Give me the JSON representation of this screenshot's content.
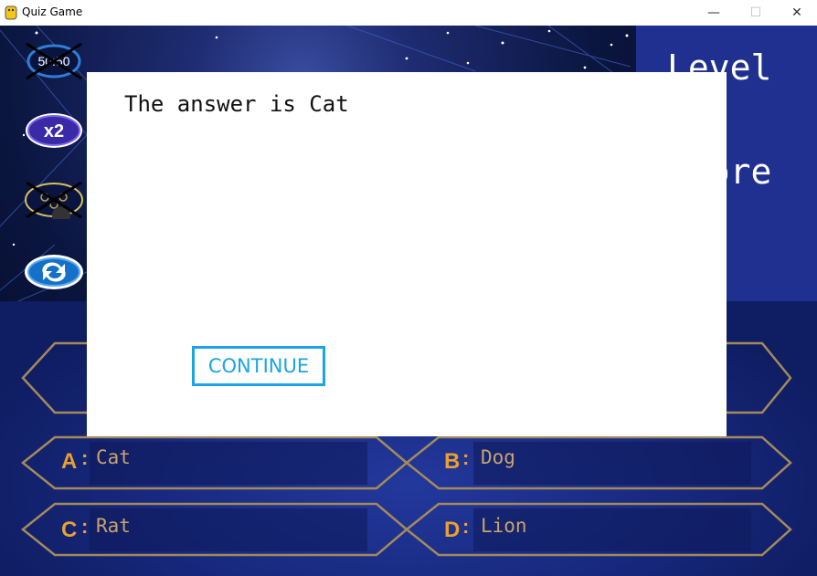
{
  "window": {
    "title": "Quiz Game",
    "minimize_glyph": "—",
    "maximize_glyph": "☐",
    "close_glyph": "✕"
  },
  "status_panel": {
    "level_label": "Level",
    "score_label": "Score"
  },
  "lifelines": [
    {
      "name": "fifty-fifty",
      "label": "50:50",
      "used": true
    },
    {
      "name": "double-chance",
      "label": "x2",
      "used": false
    },
    {
      "name": "ask-audience",
      "label": "",
      "used": true
    },
    {
      "name": "swap-question",
      "label": "",
      "used": false
    }
  ],
  "answers": [
    {
      "letter": "A",
      "text": "Cat"
    },
    {
      "letter": "B",
      "text": "Dog"
    },
    {
      "letter": "C",
      "text": "Rat"
    },
    {
      "letter": "D",
      "text": "Lion"
    }
  ],
  "dialog": {
    "message": "The answer is Cat",
    "button_label": "CONTINUE"
  },
  "colors": {
    "accent": "#1aa4e6",
    "gold": "#c7a36e",
    "letter": "#e8a030",
    "background": "#17287d"
  }
}
